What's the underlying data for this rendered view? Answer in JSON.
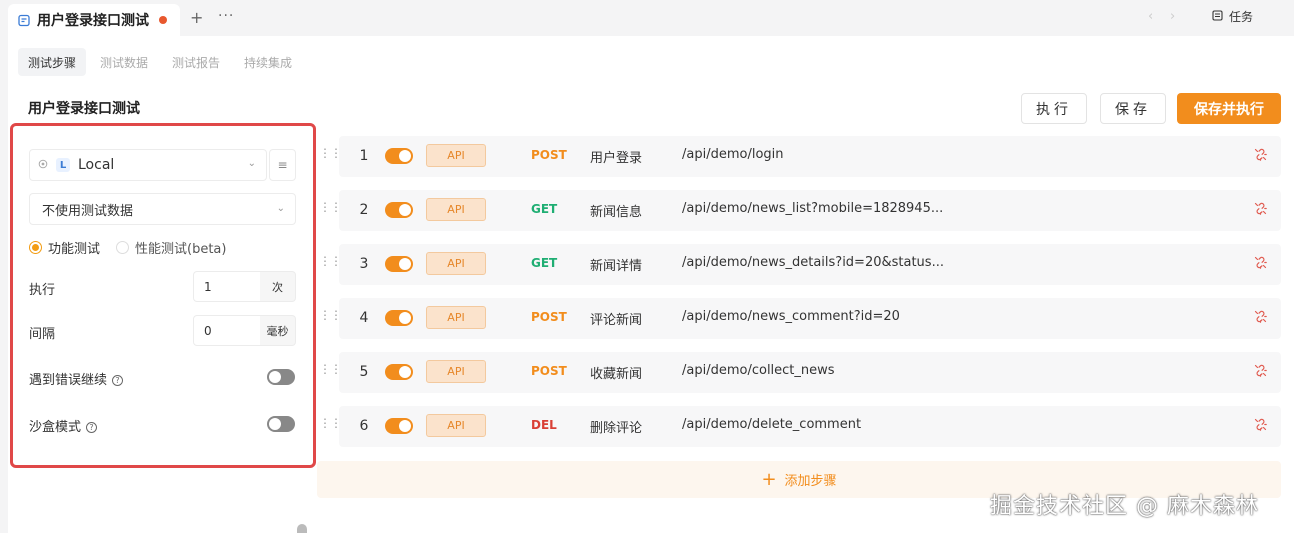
{
  "tab": {
    "title": "用户登录接口测试",
    "add": "+",
    "more": "···",
    "dirty_color": "#e8582e"
  },
  "nav": {
    "prev": "‹",
    "next": "›"
  },
  "task": {
    "label": "任务"
  },
  "subtabs": [
    {
      "label": "测试步骤",
      "active": true
    },
    {
      "label": "测试数据",
      "active": false
    },
    {
      "label": "测试报告",
      "active": false
    },
    {
      "label": "持续集成",
      "active": false
    }
  ],
  "page_title": "用户登录接口测试",
  "actions": {
    "run": "执行",
    "save": "保存",
    "save_run": "保存并执行",
    "accent": "#f28d1d"
  },
  "config": {
    "env_badge": "L",
    "env_name": "Local",
    "test_data": "不使用测试数据",
    "mode_functional": "功能测试",
    "mode_performance": "性能测试(beta)",
    "exec_label": "执行",
    "exec_value": "1",
    "exec_unit": "次",
    "interval_label": "间隔",
    "interval_value": "0",
    "interval_unit": "毫秒",
    "continue_on_error": "遇到错误继续",
    "sandbox": "沙盒模式",
    "help": "?"
  },
  "steps": [
    {
      "index": "1",
      "type": "API",
      "method": "POST",
      "name": "用户登录",
      "url": "/api/demo/login"
    },
    {
      "index": "2",
      "type": "API",
      "method": "GET",
      "name": "新闻信息",
      "url": "/api/demo/news_list?mobile=1828945..."
    },
    {
      "index": "3",
      "type": "API",
      "method": "GET",
      "name": "新闻详情",
      "url": "/api/demo/news_details?id=20&status..."
    },
    {
      "index": "4",
      "type": "API",
      "method": "POST",
      "name": "评论新闻",
      "url": "/api/demo/news_comment?id=20"
    },
    {
      "index": "5",
      "type": "API",
      "method": "POST",
      "name": "收藏新闻",
      "url": "/api/demo/collect_news"
    },
    {
      "index": "6",
      "type": "API",
      "method": "DEL",
      "name": "删除评论",
      "url": "/api/demo/delete_comment"
    }
  ],
  "method_colors": {
    "POST": "#f28d1d",
    "GET": "#1fae73",
    "DEL": "#d93f35"
  },
  "add_step": {
    "label": "添加步骤",
    "plus": "+",
    "color": "#f28d1d"
  },
  "watermark": "掘金技术社区 @ 麻木森林"
}
